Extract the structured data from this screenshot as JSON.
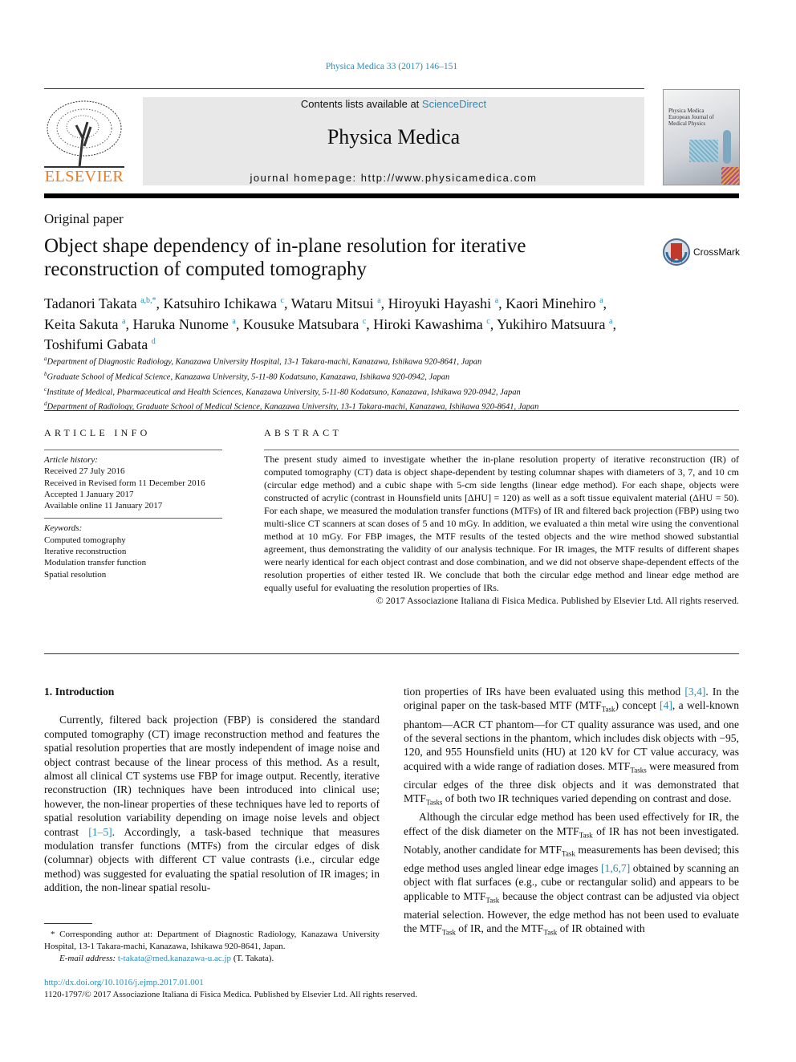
{
  "header": {
    "citation": "Physica Medica 33 (2017) 146–151",
    "contents_prefix": "Contents lists available at ",
    "contents_link": "ScienceDirect",
    "journal_title": "Physica Medica",
    "homepage": "journal homepage: http://www.physicamedica.com",
    "publisher_logo": "ELSEVIER",
    "cover_text": "Physica Medica European Journal of Medical Physics",
    "crossmark": "CrossMark"
  },
  "article": {
    "type": "Original paper",
    "title": "Object shape dependency of in-plane resolution for iterative reconstruction of computed tomography",
    "authors": [
      {
        "name": "Tadanori Takata",
        "sup": "a,b,*"
      },
      {
        "name": "Katsuhiro Ichikawa",
        "sup": "c"
      },
      {
        "name": "Wataru Mitsui",
        "sup": "a"
      },
      {
        "name": "Hiroyuki Hayashi",
        "sup": "a"
      },
      {
        "name": "Kaori Minehiro",
        "sup": "a"
      },
      {
        "name": "Keita Sakuta",
        "sup": "a"
      },
      {
        "name": "Haruka Nunome",
        "sup": "a"
      },
      {
        "name": "Kousuke Matsubara",
        "sup": "c"
      },
      {
        "name": "Hiroki Kawashima",
        "sup": "c"
      },
      {
        "name": "Yukihiro Matsuura",
        "sup": "a"
      },
      {
        "name": "Toshifumi Gabata",
        "sup": "d"
      }
    ],
    "affiliations": [
      {
        "sup": "a",
        "text": "Department of Diagnostic Radiology, Kanazawa University Hospital, 13-1 Takara-machi, Kanazawa, Ishikawa 920-8641, Japan"
      },
      {
        "sup": "b",
        "text": "Graduate School of Medical Science, Kanazawa University, 5-11-80 Kodatsuno, Kanazawa, Ishikawa 920-0942, Japan"
      },
      {
        "sup": "c",
        "text": "Institute of Medical, Pharmaceutical and Health Sciences, Kanazawa University, 5-11-80 Kodatsuno, Kanazawa, Ishikawa 920-0942, Japan"
      },
      {
        "sup": "d",
        "text": "Department of Radiology, Graduate School of Medical Science, Kanazawa University, 13-1 Takara-machi, Kanazawa, Ishikawa 920-8641, Japan"
      }
    ]
  },
  "info": {
    "heading": "ARTICLE INFO",
    "history_label": "Article history:",
    "history": [
      "Received 27 July 2016",
      "Received in Revised form 11 December 2016",
      "Accepted 1 January 2017",
      "Available online 11 January 2017"
    ],
    "keywords_label": "Keywords:",
    "keywords": [
      "Computed tomography",
      "Iterative reconstruction",
      "Modulation transfer function",
      "Spatial resolution"
    ]
  },
  "abstract": {
    "heading": "ABSTRACT",
    "text": "The present study aimed to investigate whether the in-plane resolution property of iterative reconstruction (IR) of computed tomography (CT) data is object shape-dependent by testing columnar shapes with diameters of 3, 7, and 10 cm (circular edge method) and a cubic shape with 5-cm side lengths (linear edge method). For each shape, objects were constructed of acrylic (contrast in Hounsfield units [ΔHU] = 120) as well as a soft tissue equivalent material (ΔHU = 50). For each shape, we measured the modulation transfer functions (MTFs) of IR and filtered back projection (FBP) using two multi-slice CT scanners at scan doses of 5 and 10 mGy. In addition, we evaluated a thin metal wire using the conventional method at 10 mGy. For FBP images, the MTF results of the tested objects and the wire method showed substantial agreement, thus demonstrating the validity of our analysis technique. For IR images, the MTF results of different shapes were nearly identical for each object contrast and dose combination, and we did not observe shape-dependent effects of the resolution properties of either tested IR. We conclude that both the circular edge method and linear edge method are equally useful for evaluating the resolution properties of IRs.",
    "copyright": "© 2017 Associazione Italiana di Fisica Medica. Published by Elsevier Ltd. All rights reserved."
  },
  "body": {
    "left": [
      {
        "heading": true,
        "segs": [
          {
            "t": "1. Introduction"
          }
        ]
      },
      {
        "segs": [
          {
            "t": "Currently, filtered back projection (FBP) is considered the standard computed tomography (CT) image reconstruction method and features the spatial resolution properties that are mostly independent of image noise and object contrast because of the linear process of this method. As a result, almost all clinical CT systems use FBP for image output. Recently, iterative reconstruction (IR) techniques have been introduced into clinical use; however, the non-linear properties of these techniques have led to reports of spatial resolution variability depending on image noise levels and object contrast "
          },
          {
            "t": "[1–5]",
            "link": true
          },
          {
            "t": ". Accordingly, a task-based technique that measures modulation transfer functions (MTFs) from the circular edges of disk (columnar) objects with different CT value contrasts (i.e., circular edge method) was suggested for evaluating the spatial resolution of IR images; in addition, the non-linear spatial resolu-"
          }
        ]
      }
    ],
    "right": [
      {
        "noind": true,
        "segs": [
          {
            "t": "tion properties of IRs have been evaluated using this method "
          },
          {
            "t": "[3,4]",
            "link": true
          },
          {
            "t": ". In the original paper on the task-based MTF (MTF"
          },
          {
            "t": "Task",
            "sub": true
          },
          {
            "t": ") concept "
          },
          {
            "t": "[4]",
            "link": true
          },
          {
            "t": ", a well-known phantom—ACR CT phantom—for CT quality assurance was used, and one of the several sections in the phantom, which includes disk objects with −95, 120, and 955 Hounsfield units (HU) at 120 kV for CT value accuracy, was acquired with a wide range of radiation doses. MTF"
          },
          {
            "t": "Tasks",
            "sub": true
          },
          {
            "t": " were measured from circular edges of the three disk objects and it was demonstrated that MTF"
          },
          {
            "t": "Tasks",
            "sub": true
          },
          {
            "t": " of both two IR techniques varied depending on contrast and dose."
          }
        ]
      },
      {
        "segs": [
          {
            "t": "Although the circular edge method has been used effectively for IR, the effect of the disk diameter on the MTF"
          },
          {
            "t": "Task",
            "sub": true
          },
          {
            "t": " of IR has not been investigated. Notably, another candidate for MTF"
          },
          {
            "t": "Task",
            "sub": true
          },
          {
            "t": " measurements has been devised; this edge method uses angled linear edge images "
          },
          {
            "t": "[1,6,7]",
            "link": true
          },
          {
            "t": " obtained by scanning an object with flat surfaces (e.g., cube or rectangular solid) and appears to be applicable to MTF"
          },
          {
            "t": "Task",
            "sub": true
          },
          {
            "t": " because the object contrast can be adjusted via object material selection. However, the edge method has not been used to evaluate the MTF"
          },
          {
            "t": "Task",
            "sub": true
          },
          {
            "t": " of IR, and the MTF"
          },
          {
            "t": "Task",
            "sub": true
          },
          {
            "t": " of IR obtained with"
          }
        ]
      }
    ]
  },
  "footnote": {
    "corresponding": "* Corresponding author at: Department of Diagnostic Radiology, Kanazawa University Hospital, 13-1 Takara-machi, Kanazawa, Ishikawa 920-8641, Japan.",
    "email_label": "E-mail address: ",
    "email": "t-takata@med.kanazawa-u.ac.jp",
    "email_suffix": " (T. Takata)."
  },
  "doi": {
    "link": "http://dx.doi.org/10.1016/j.ejmp.2017.01.001",
    "issn": "1120-1797/© 2017 Associazione Italiana di Fisica Medica. Published by Elsevier Ltd. All rights reserved."
  },
  "colors": {
    "link": "#2a8bb8",
    "elsevier": "#f07b1f",
    "banner": "#e8e8e8"
  }
}
